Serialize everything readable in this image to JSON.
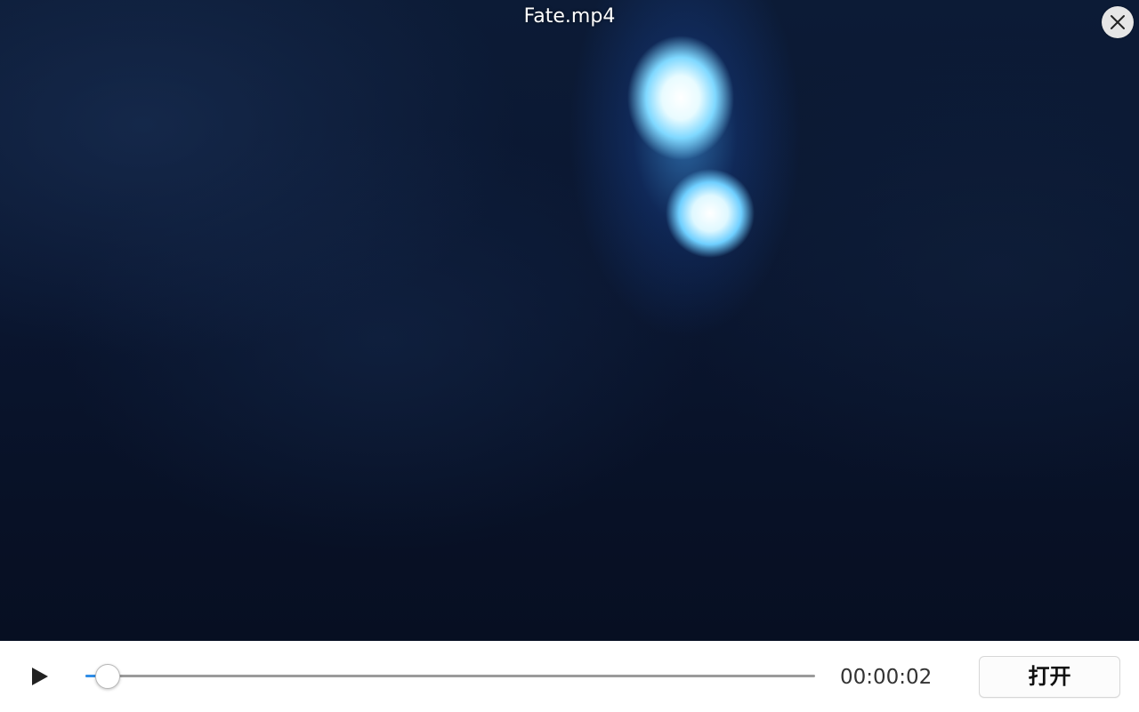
{
  "window": {
    "title": "Fate.mp4"
  },
  "video": {
    "description_colors": {
      "background": "#0a1630",
      "glow": "#7fd8ff"
    }
  },
  "controls": {
    "play_icon": "play-icon",
    "close_icon": "close-icon",
    "time": "00:00:02",
    "progress_fraction": 0.03,
    "open_label": "打开",
    "accent_color": "#2f8ee8"
  }
}
